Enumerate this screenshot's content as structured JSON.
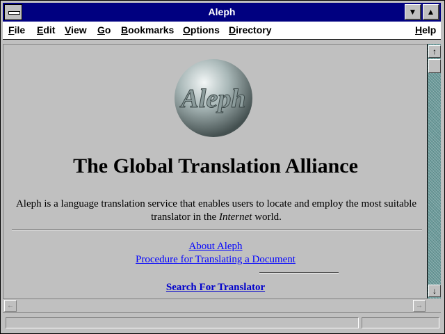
{
  "window": {
    "title": "Aleph",
    "minimize_glyph": "▼",
    "maximize_glyph": "▲"
  },
  "menubar": {
    "items": [
      "File",
      "Edit",
      "View",
      "Go",
      "Bookmarks",
      "Options",
      "Directory"
    ],
    "help": "Help"
  },
  "page": {
    "logo_text": "Aleph",
    "heading": "The Global Translation Alliance",
    "intro_before_em": "Aleph is a language translation service that enables users to locate and employ the most suitable translator in the ",
    "intro_em": "Internet",
    "intro_after_em": " world.",
    "links": [
      {
        "label": "About Aleph"
      },
      {
        "label": "Procedure for Translating a Document"
      }
    ],
    "search_link": "Search For Translator"
  },
  "scrollbar": {
    "up_glyph": "↑",
    "down_glyph": "↓",
    "left_glyph": "←",
    "right_glyph": "→"
  },
  "colors": {
    "titlebar": "#000080",
    "link": "#0000ff",
    "background": "#c0c0c0"
  }
}
